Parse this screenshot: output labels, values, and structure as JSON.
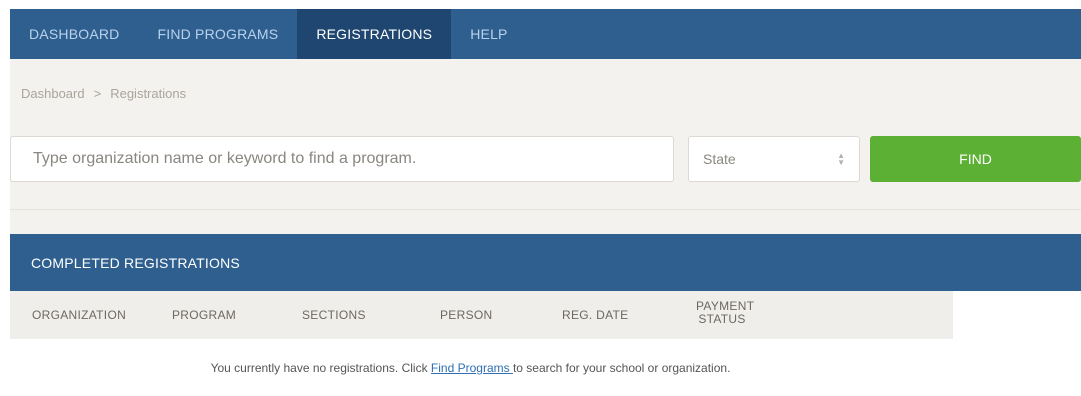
{
  "nav": {
    "items": [
      {
        "label": "DASHBOARD"
      },
      {
        "label": "FIND PROGRAMS"
      },
      {
        "label": "REGISTRATIONS"
      },
      {
        "label": "HELP"
      }
    ],
    "active_index": 2
  },
  "breadcrumb": {
    "items": [
      "Dashboard",
      "Registrations"
    ],
    "separator": ">"
  },
  "search": {
    "placeholder": "Type organization name or keyword to find a program.",
    "value": ""
  },
  "state_select": {
    "selected": "State"
  },
  "find_button": {
    "label": "FIND"
  },
  "panel": {
    "title": "COMPLETED REGISTRATIONS"
  },
  "table": {
    "columns": [
      "ORGANIZATION",
      "PROGRAM",
      "SECTIONS",
      "PERSON",
      "REG. DATE",
      "PAYMENT",
      "STATUS"
    ],
    "empty_message": {
      "prefix": "You currently have no registrations. Click ",
      "link": "Find Programs ",
      "suffix": "to search for your school or organization."
    }
  },
  "colors": {
    "navbar": "#2f5f8f",
    "nav_active": "#1f4670",
    "find_button": "#5cb034",
    "link": "#2f6fb2"
  }
}
